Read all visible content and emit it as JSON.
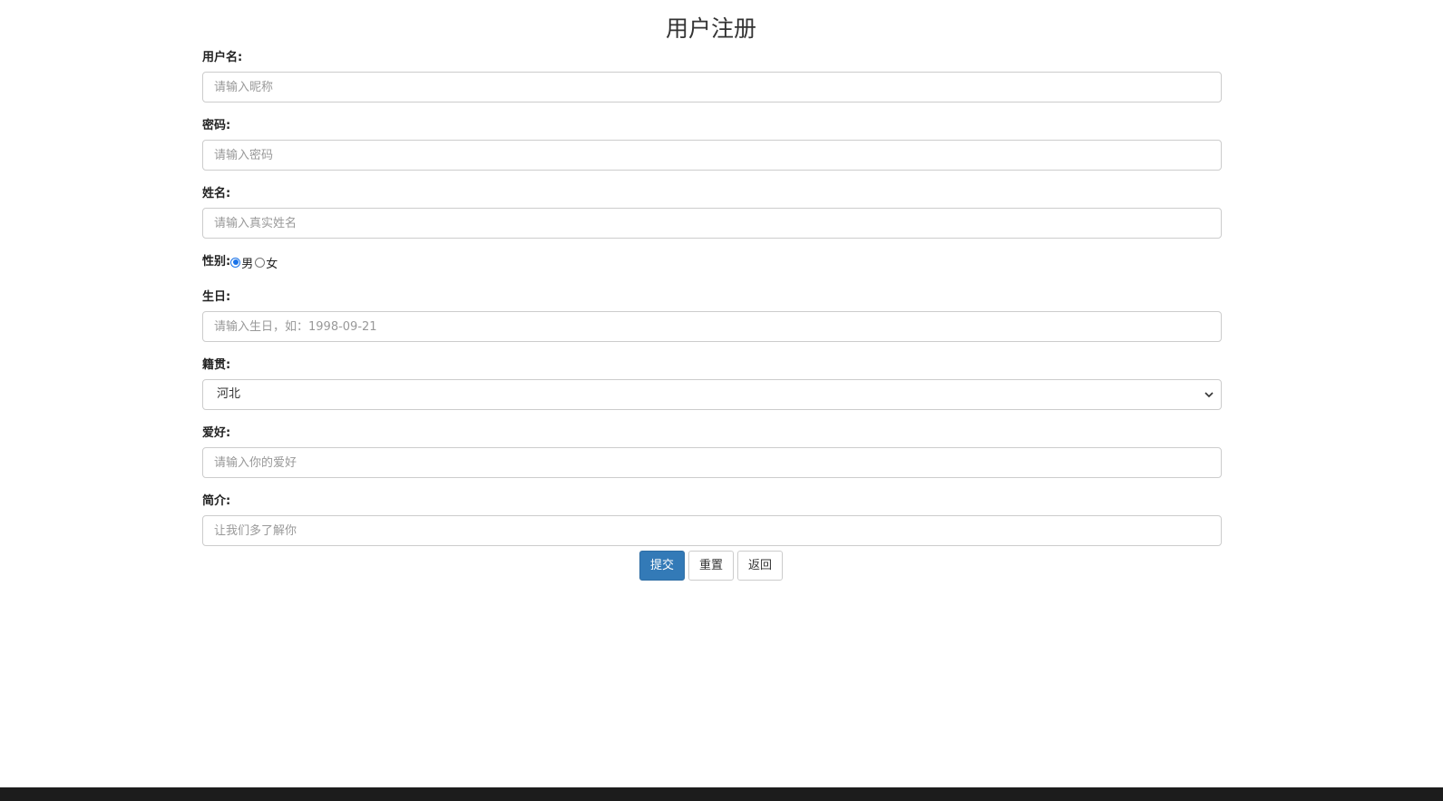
{
  "page": {
    "title": "用户注册"
  },
  "form": {
    "username": {
      "label": "用户名:",
      "placeholder": "请输入昵称"
    },
    "password": {
      "label": "密码:",
      "placeholder": "请输入密码"
    },
    "name": {
      "label": "姓名:",
      "placeholder": "请输入真实姓名"
    },
    "gender": {
      "label": "性别:",
      "options": [
        {
          "label": "男",
          "checked": true
        },
        {
          "label": "女",
          "checked": false
        }
      ]
    },
    "birthday": {
      "label": "生日:",
      "placeholder": "请输入生日，如：1998-09-21"
    },
    "hometown": {
      "label": "籍贯:",
      "selected": "河北"
    },
    "hobby": {
      "label": "爱好:",
      "placeholder": "请输入你的爱好"
    },
    "intro": {
      "label": "简介:",
      "placeholder": "让我们多了解你"
    }
  },
  "buttons": {
    "submit": "提交",
    "reset": "重置",
    "back": "返回"
  },
  "colors": {
    "primary": "#337ab7",
    "radio_checked": "#1a73e8"
  }
}
